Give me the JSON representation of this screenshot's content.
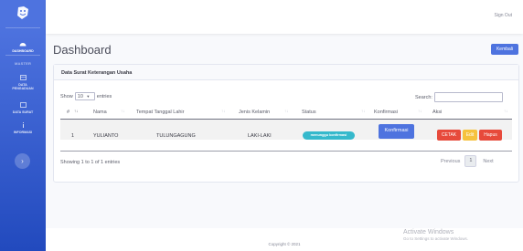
{
  "sidebar": {
    "brand_icon": "laugh-wink-icon",
    "items": [
      {
        "label": "Dashboard",
        "icon": "tachometer-icon"
      },
      {
        "label": "Data Pengaduan",
        "icon": "table-icon"
      },
      {
        "label": "Data Surat",
        "icon": "folder-icon"
      },
      {
        "label": "Informasi",
        "icon": "info-icon"
      }
    ],
    "heading": "MASTER",
    "toggle_icon": "chevron-right-icon",
    "toggle_glyph": "›"
  },
  "topbar": {
    "signout_label": "Sign Out"
  },
  "page": {
    "title": "Dashboard",
    "back_label": "Kembali"
  },
  "card": {
    "title": "Data Surat Keterangan Usaha",
    "show_label": "Show",
    "entries_value": "10",
    "entries_label": "entries",
    "search_label": "Search:",
    "search_value": "",
    "columns": [
      "#",
      "Nama",
      "Tempat Tanggal Lahir",
      "Jenis Kelamin",
      "Status",
      "Konfirmasi",
      "Aksi"
    ],
    "rows": [
      {
        "no": "1",
        "nama": "YULIANTO",
        "ttl": "TULUNGAGUNG",
        "jk": "LAKI-LAKI",
        "status": "menunggu konfirmasi",
        "konfirmasi": "Konfirmasi",
        "cetak": "CETAK",
        "edit": "Edit",
        "hapus": "Hapus"
      }
    ],
    "info": "Showing 1 to 1 of 1 entries",
    "pager": {
      "previous": "Previous",
      "page": "1",
      "next": "Next"
    }
  },
  "footer": {
    "copyright": "Copyright © 2021"
  },
  "watermark": {
    "line1": "Activate Windows",
    "line2": "Go to Settings to activate Windows."
  },
  "colors": {
    "sidebar_primary": "#4e73df",
    "badge_info": "#36b9cc",
    "danger": "#e74a3b",
    "warning": "#f6c23e"
  }
}
